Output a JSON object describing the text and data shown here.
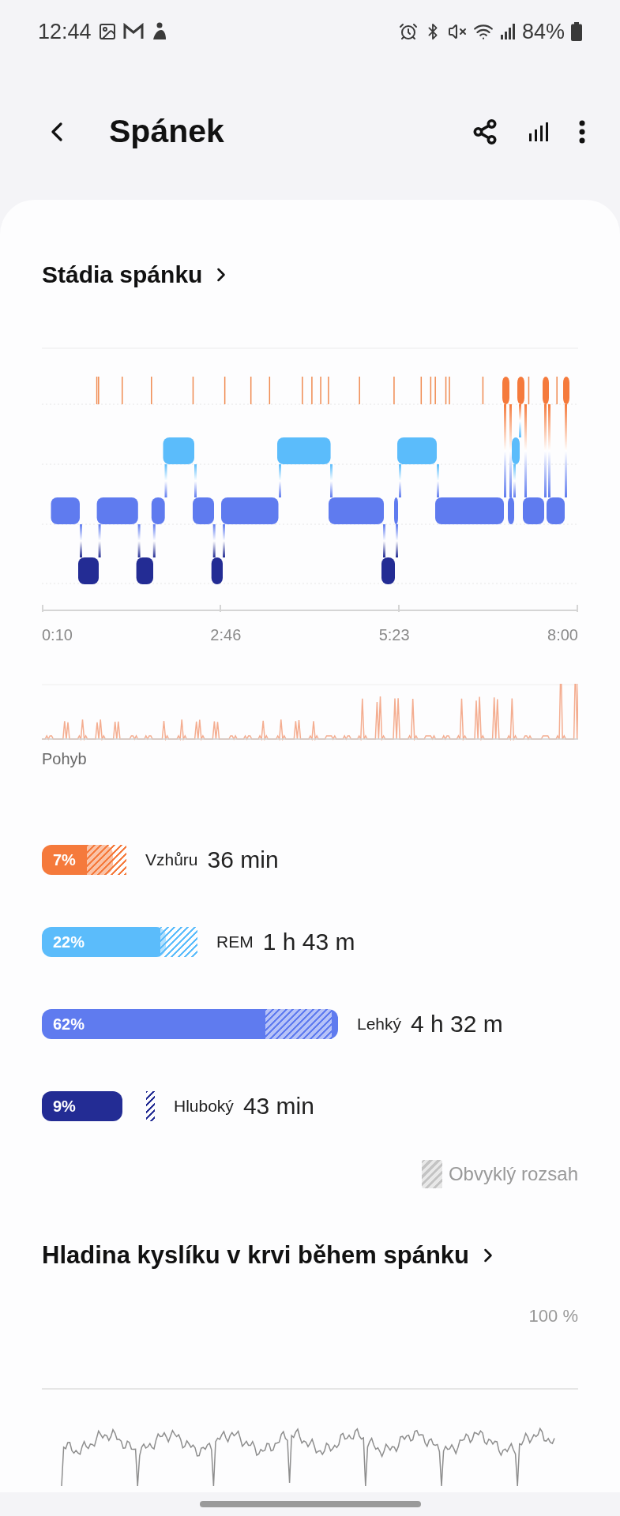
{
  "status_bar": {
    "time": "12:44",
    "battery": "84%"
  },
  "header": {
    "title": "Spánek"
  },
  "sleep_stages": {
    "title": "Stádia spánku",
    "chart": {
      "x_labels": [
        "0:10",
        "2:46",
        "5:23",
        "8:00"
      ]
    },
    "movement": {
      "label": "Pohyb"
    },
    "stages": [
      {
        "percent": "7%",
        "label": "Vzhůru",
        "duration": "36 min",
        "color": "#f57a3c"
      },
      {
        "percent": "22%",
        "label": "REM",
        "duration": "1 h 43 m",
        "color": "#5bbcfb"
      },
      {
        "percent": "62%",
        "label": "Lehký",
        "duration": "4 h 32 m",
        "color": "#5f7bef"
      },
      {
        "percent": "9%",
        "label": "Hluboký",
        "duration": "43 min",
        "color": "#232c94"
      }
    ],
    "legend": "Obvyklý rozsah"
  },
  "blood_oxygen": {
    "title": "Hladina kyslíku v krvi během spánku",
    "top_label": "100 %"
  }
}
